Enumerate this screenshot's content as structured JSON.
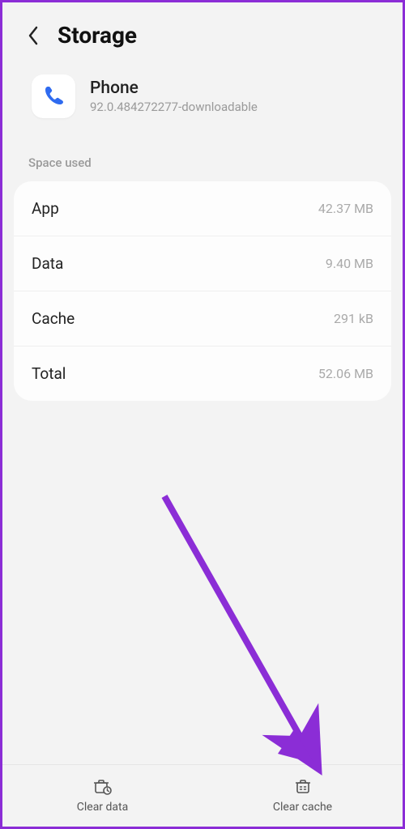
{
  "header": {
    "title": "Storage"
  },
  "app": {
    "name": "Phone",
    "version": "92.0.484272277-downloadable"
  },
  "section": {
    "label": "Space used"
  },
  "rows": {
    "app": {
      "label": "App",
      "value": "42.37 MB"
    },
    "data": {
      "label": "Data",
      "value": "9.40 MB"
    },
    "cache": {
      "label": "Cache",
      "value": "291 kB"
    },
    "total": {
      "label": "Total",
      "value": "52.06 MB"
    }
  },
  "actions": {
    "clear_data": "Clear data",
    "clear_cache": "Clear cache"
  },
  "colors": {
    "accent": "#8b2dd6",
    "phone_icon": "#2f6bf0"
  }
}
